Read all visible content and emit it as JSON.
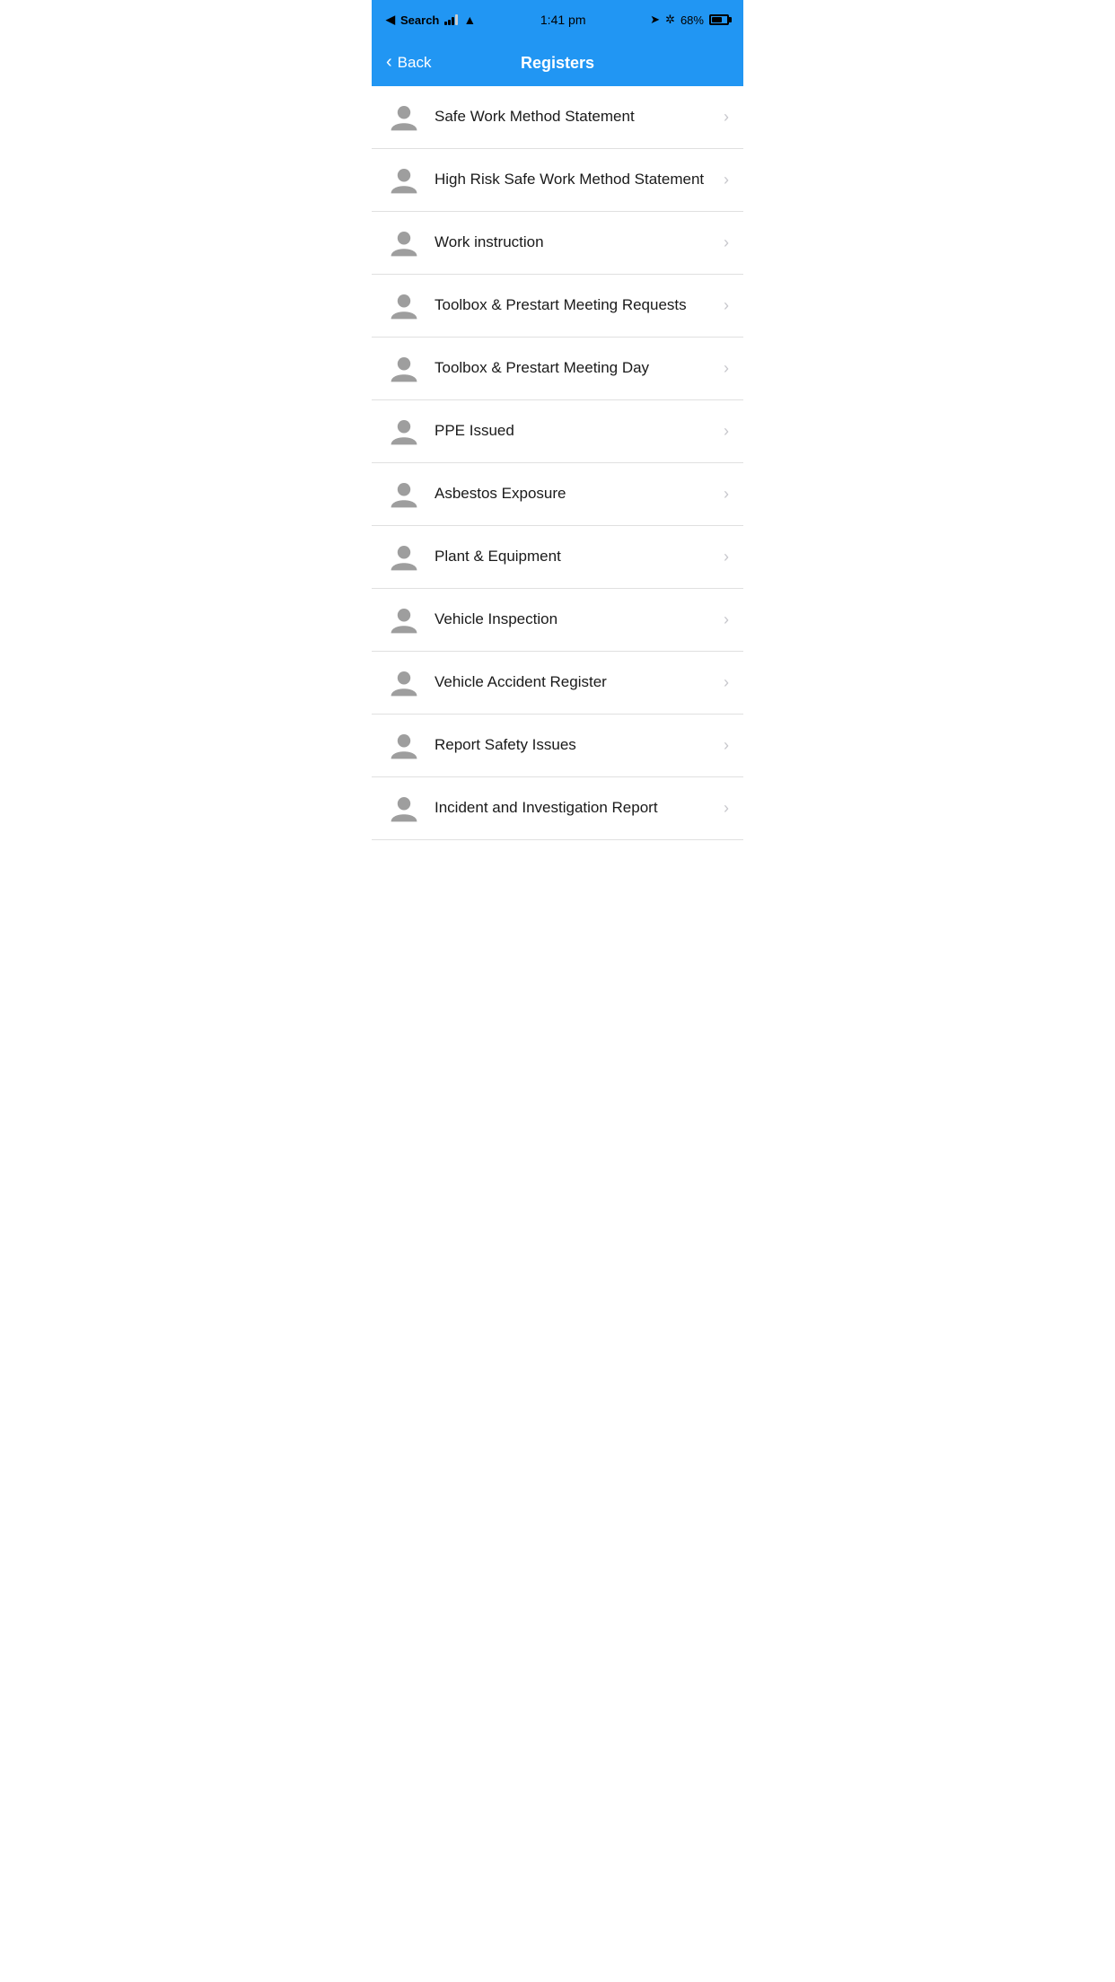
{
  "statusBar": {
    "carrier": "Search",
    "time": "1:41 pm",
    "battery": "68%",
    "batteryFill": 68
  },
  "navBar": {
    "backLabel": "Back",
    "title": "Registers"
  },
  "listItems": [
    {
      "id": 1,
      "label": "Safe Work Method Statement"
    },
    {
      "id": 2,
      "label": "High Risk Safe Work Method Statement"
    },
    {
      "id": 3,
      "label": "Work instruction"
    },
    {
      "id": 4,
      "label": "Toolbox & Prestart Meeting Requests"
    },
    {
      "id": 5,
      "label": "Toolbox & Prestart Meeting Day"
    },
    {
      "id": 6,
      "label": "PPE Issued"
    },
    {
      "id": 7,
      "label": "Asbestos Exposure"
    },
    {
      "id": 8,
      "label": "Plant & Equipment"
    },
    {
      "id": 9,
      "label": "Vehicle Inspection"
    },
    {
      "id": 10,
      "label": "Vehicle Accident Register"
    },
    {
      "id": 11,
      "label": "Report Safety Issues"
    },
    {
      "id": 12,
      "label": "Incident and Investigation Report"
    }
  ],
  "icons": {
    "personIcon": "person",
    "chevronRight": "›",
    "chevronLeft": "‹"
  },
  "colors": {
    "primary": "#2196F3",
    "listBorder": "#e0e0e0",
    "iconColor": "#9e9e9e",
    "chevronColor": "#c7c7cc"
  }
}
